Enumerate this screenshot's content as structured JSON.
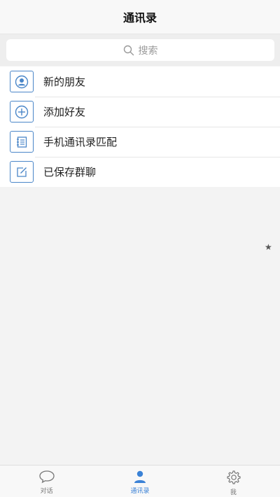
{
  "header": {
    "title": "通讯录"
  },
  "search": {
    "placeholder": "搜索",
    "icon": "search-icon"
  },
  "list": {
    "items": [
      {
        "label": "新的朋友",
        "icon": "user-icon"
      },
      {
        "label": "添加好友",
        "icon": "add-circle-icon"
      },
      {
        "label": "手机通讯录匹配",
        "icon": "contacts-book-icon"
      },
      {
        "label": "已保存群聊",
        "icon": "edit-icon"
      }
    ]
  },
  "floating": {
    "star": "★"
  },
  "tabbar": {
    "active_color": "#3b82d6",
    "inactive_color": "#777777",
    "tabs": [
      {
        "label": "对话",
        "icon": "chat-bubble-icon",
        "active": false
      },
      {
        "label": "通讯录",
        "icon": "contacts-person-icon",
        "active": true
      },
      {
        "label": "我",
        "icon": "gear-icon",
        "active": false
      }
    ]
  }
}
